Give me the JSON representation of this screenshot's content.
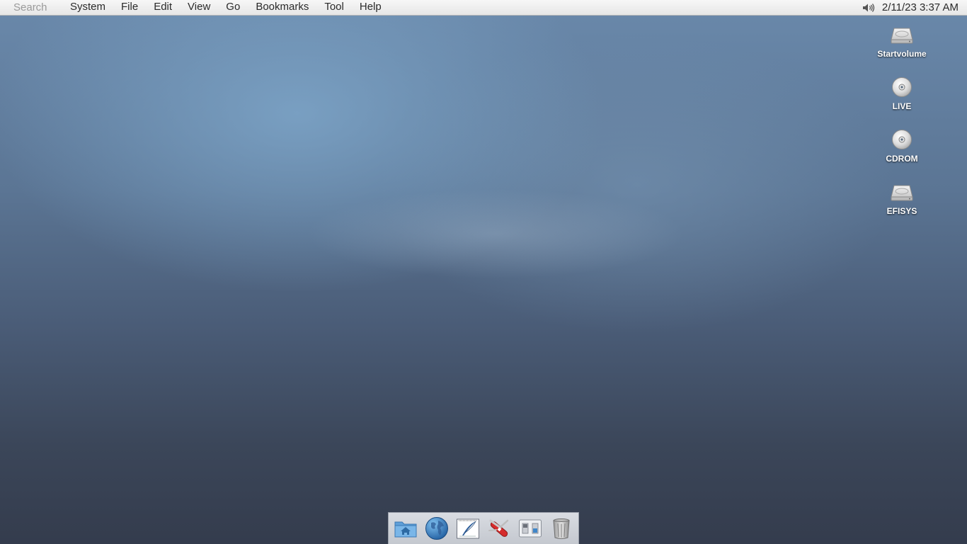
{
  "menubar": {
    "search_placeholder": "Search",
    "menus": [
      "System",
      "File",
      "Edit",
      "View",
      "Go",
      "Bookmarks",
      "Tool",
      "Help"
    ],
    "tray": {
      "volume_icon": "speaker-icon",
      "clock": "2/11/23 3:37 AM"
    }
  },
  "desktop": {
    "icons": [
      {
        "label": "Startvolume",
        "icon": "hard-drive-icon"
      },
      {
        "label": "LIVE",
        "icon": "cd-disc-icon"
      },
      {
        "label": "CDROM",
        "icon": "cd-disc-icon"
      },
      {
        "label": "EFISYS",
        "icon": "hard-drive-icon"
      }
    ]
  },
  "dock": {
    "items": [
      {
        "name": "home-folder",
        "icon": "home-folder-icon"
      },
      {
        "name": "web-browser",
        "icon": "globe-icon"
      },
      {
        "name": "text-editor",
        "icon": "quill-document-icon"
      },
      {
        "name": "system-tools",
        "icon": "swiss-knife-icon"
      },
      {
        "name": "preferences",
        "icon": "toggle-switches-icon"
      },
      {
        "name": "trash",
        "icon": "trash-icon"
      }
    ]
  },
  "colors": {
    "menubar_bg": "#ededed",
    "accent_blue": "#3f86c9",
    "dock_bg": "#cdd1d8"
  }
}
